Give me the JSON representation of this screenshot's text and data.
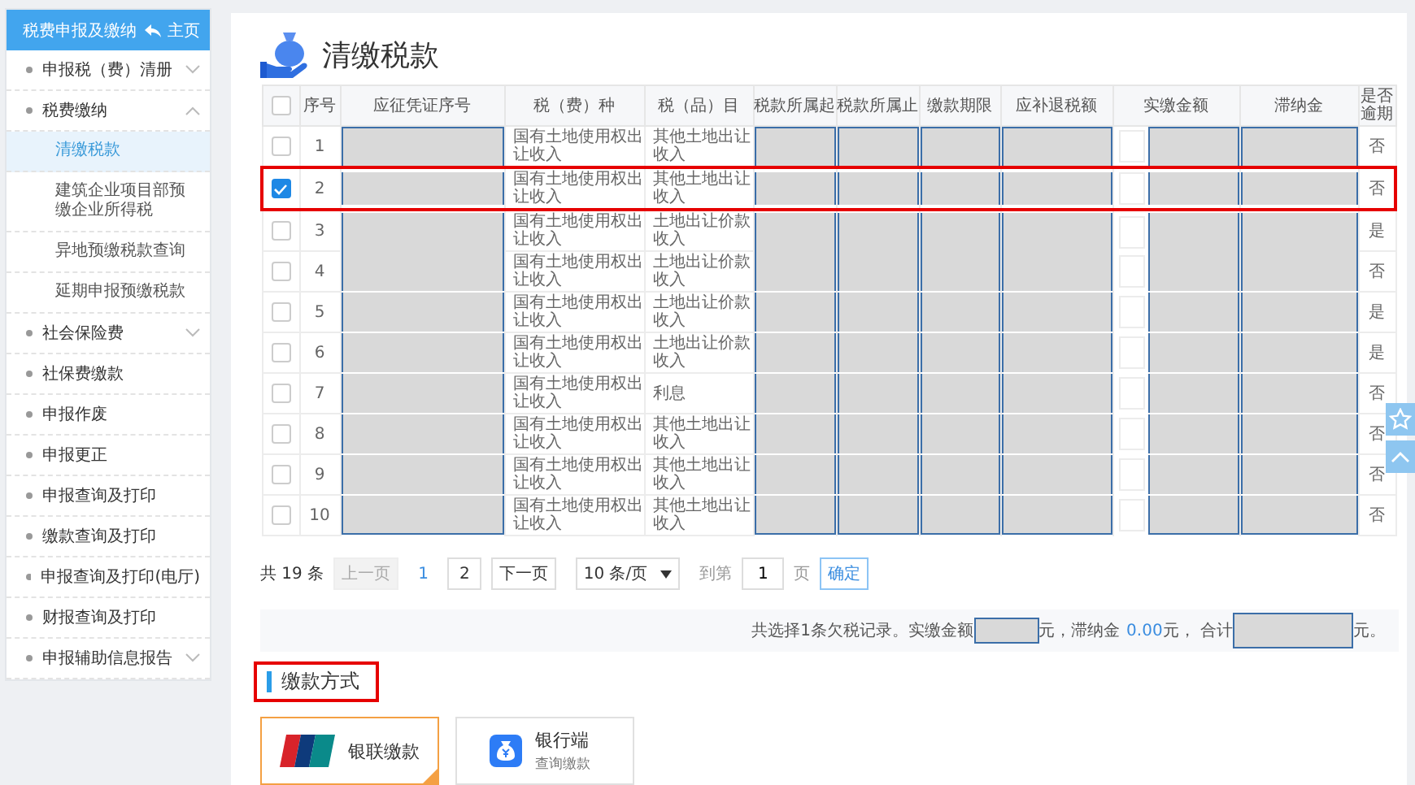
{
  "sidebar": {
    "title": "税费申报及缴纳",
    "home": "主页",
    "items": [
      {
        "label": "申报税（费）清册",
        "kind": "group",
        "expanded": false
      },
      {
        "label": "税费缴纳",
        "kind": "group",
        "expanded": true,
        "children": [
          {
            "label": "清缴税款",
            "selected": true
          },
          {
            "label": "建筑企业项目部预缴企业所得税",
            "selected": false
          },
          {
            "label": "异地预缴税款查询",
            "selected": false
          },
          {
            "label": "延期申报预缴税款",
            "selected": false
          }
        ]
      },
      {
        "label": "社会保险费",
        "kind": "group",
        "expanded": false
      },
      {
        "label": "社保费缴款",
        "kind": "link"
      },
      {
        "label": "申报作废",
        "kind": "link"
      },
      {
        "label": "申报更正",
        "kind": "link"
      },
      {
        "label": "申报查询及打印",
        "kind": "link"
      },
      {
        "label": "缴款查询及打印",
        "kind": "link"
      },
      {
        "label": "申报查询及打印(电厅)",
        "kind": "link"
      },
      {
        "label": "财报查询及打印",
        "kind": "link"
      },
      {
        "label": "申报辅助信息报告",
        "kind": "group",
        "expanded": false
      }
    ]
  },
  "page": {
    "title": "清缴税款"
  },
  "table": {
    "all_checked": false,
    "columns": [
      {
        "kind": "check"
      },
      {
        "label": "序号",
        "kind": "number"
      },
      {
        "label": "应征凭证序号",
        "kind": "redacted"
      },
      {
        "label": "税（费）种",
        "kind": "tax_type"
      },
      {
        "label": "税（品）目",
        "kind": "tax_item"
      },
      {
        "label": "税款所属起",
        "kind": "redacted"
      },
      {
        "label": "税款所属止",
        "kind": "redacted"
      },
      {
        "label": "缴款期限",
        "kind": "redacted"
      },
      {
        "label": "应补退税额",
        "kind": "redacted"
      },
      {
        "label": "实缴金额",
        "kind": "amount"
      },
      {
        "label": "滞纳金",
        "kind": "redacted"
      },
      {
        "label": "是否逾期",
        "kind": "overdue"
      }
    ],
    "rows": [
      {
        "checked": false,
        "highlighted": false,
        "number": "1",
        "tax_type": "国有土地使用权出让收入",
        "tax_item": "其他土地出让收入",
        "overdue": "否"
      },
      {
        "checked": true,
        "highlighted": true,
        "number": "2",
        "tax_type": "国有土地使用权出让收入",
        "tax_item": "其他土地出让收入",
        "overdue": "否"
      },
      {
        "checked": false,
        "highlighted": false,
        "number": "3",
        "tax_type": "国有土地使用权出让收入",
        "tax_item": "土地出让价款收入",
        "overdue": "是"
      },
      {
        "checked": false,
        "highlighted": false,
        "number": "4",
        "tax_type": "国有土地使用权出让收入",
        "tax_item": "土地出让价款收入",
        "overdue": "否"
      },
      {
        "checked": false,
        "highlighted": false,
        "number": "5",
        "tax_type": "国有土地使用权出让收入",
        "tax_item": "土地出让价款收入",
        "overdue": "是"
      },
      {
        "checked": false,
        "highlighted": false,
        "number": "6",
        "tax_type": "国有土地使用权出让收入",
        "tax_item": "土地出让价款收入",
        "overdue": "是"
      },
      {
        "checked": false,
        "highlighted": false,
        "number": "7",
        "tax_type": "国有土地使用权出让收入",
        "tax_item": "利息",
        "overdue": "否"
      },
      {
        "checked": false,
        "highlighted": false,
        "number": "8",
        "tax_type": "国有土地使用权出让收入",
        "tax_item": "其他土地出让收入",
        "overdue": "否"
      },
      {
        "checked": false,
        "highlighted": false,
        "number": "9",
        "tax_type": "国有土地使用权出让收入",
        "tax_item": "其他土地出让收入",
        "overdue": "否"
      },
      {
        "checked": false,
        "highlighted": false,
        "number": "10",
        "tax_type": "国有土地使用权出让收入",
        "tax_item": "其他土地出让收入",
        "overdue": "否"
      }
    ]
  },
  "pagination": {
    "total": "共 19 条",
    "prev": "上一页",
    "prev_disabled": true,
    "pages": [
      {
        "label": "1",
        "selected": true
      },
      {
        "label": "2",
        "selected": false
      }
    ],
    "next": "下一页",
    "page_size": "10 条/页",
    "goto_label": "到第",
    "goto_value": "1",
    "page_unit": "页",
    "confirm": "确定"
  },
  "summary": {
    "text_1": "共选择1条欠税记录。实缴金额",
    "text_2": "元，滞纳金",
    "late_fee": "0.00",
    "text_3": "元， 合计",
    "text_4": "元。"
  },
  "payment": {
    "title": "缴款方式",
    "highlighted": true,
    "options": [
      {
        "kind": "unionpay",
        "label": "银联缴款",
        "selected": true
      },
      {
        "kind": "bank",
        "label": "银行端",
        "sublabel": "查询缴款",
        "selected": false
      }
    ]
  }
}
